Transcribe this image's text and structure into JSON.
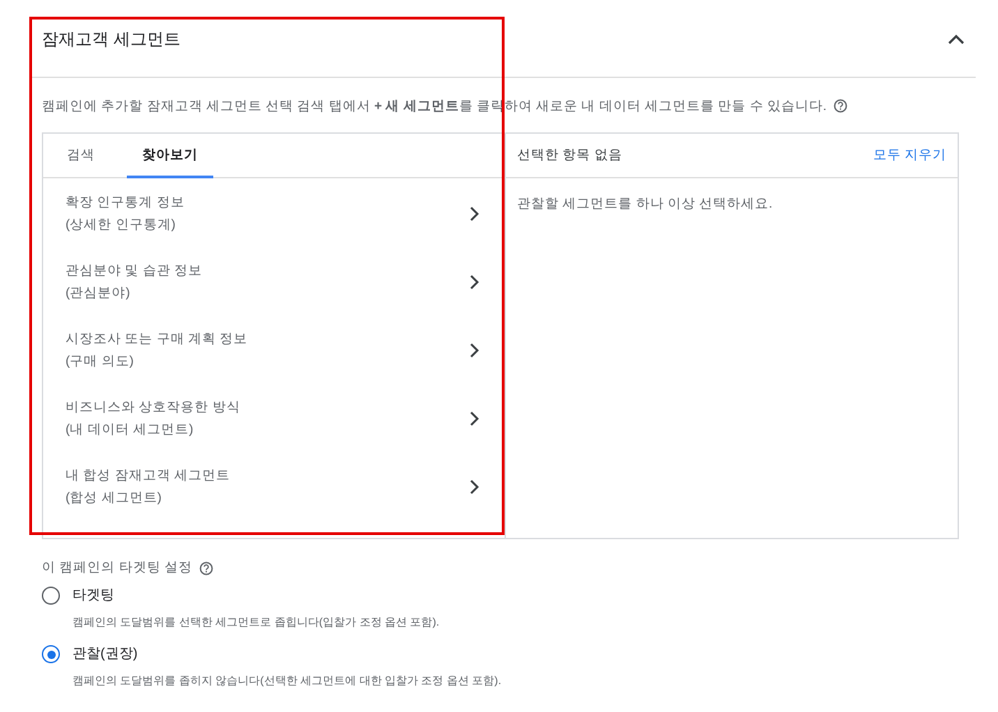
{
  "section": {
    "title": "잠재고객 세그먼트",
    "expanded": true,
    "description": "캠페인에 추가할 잠재고객 세그먼트 선택 검색 탭에서 **+ 새 세그먼트**를 클릭하여 새로운 내 데이터 세그먼트를 만들 수 있습니다."
  },
  "tabs": [
    {
      "label": "검색",
      "selected": false
    },
    {
      "label": "찾아보기",
      "selected": true
    }
  ],
  "categories": [
    {
      "title": "확장 인구통계 정보",
      "subtitle": "(상세한 인구통계)"
    },
    {
      "title": "관심분야 및 습관 정보",
      "subtitle": "(관심분야)"
    },
    {
      "title": "시장조사 또는 구매 계획 정보",
      "subtitle": "(구매 의도)"
    },
    {
      "title": "비즈니스와 상호작용한 방식",
      "subtitle": "(내 데이터 세그먼트)"
    },
    {
      "title": "내 합성 잠재고객 세그먼트",
      "subtitle": "(합성 세그먼트)"
    }
  ],
  "selection": {
    "heading": "선택한 항목 없음",
    "clear_link": "모두 지우기",
    "empty_message": "관찰할 세그먼트를 하나 이상 선택하세요."
  },
  "targeting": {
    "label": "이 캠페인의 타겟팅 설정",
    "options": [
      {
        "title": "타겟팅",
        "description": "캠페인의 도달범위를 선택한 세그먼트로 좁힙니다(입찰가 조정 옵션 포함).",
        "selected": false
      },
      {
        "title": "관찰(권장)",
        "description": "캠페인의 도달범위를 좁히지 않습니다(선택한 세그먼트에 대한 입찰가 조정 옵션 포함).",
        "selected": true
      }
    ]
  }
}
